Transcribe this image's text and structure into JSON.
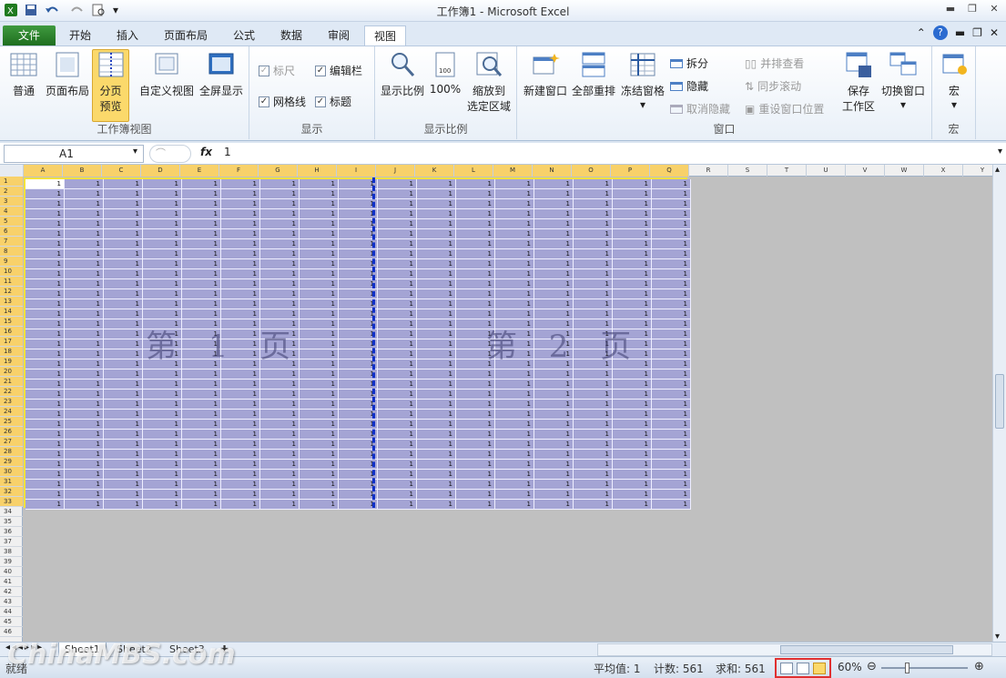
{
  "window": {
    "title": "工作簿1 - Microsoft Excel"
  },
  "tabs": [
    "文件",
    "开始",
    "插入",
    "页面布局",
    "公式",
    "数据",
    "审阅",
    "视图"
  ],
  "ribbon": {
    "workbook_views": {
      "label": "工作簿视图",
      "normal": "普通",
      "page_layout": "页面布局",
      "page_break_1": "分页",
      "page_break_2": "预览",
      "custom": "自定义视图",
      "full": "全屏显示"
    },
    "show": {
      "label": "显示",
      "ruler": "标尺",
      "formula_bar": "编辑栏",
      "gridlines": "网格线",
      "headings": "标题"
    },
    "zoom": {
      "label": "显示比例",
      "zoom": "显示比例",
      "hundred": "100%",
      "sel1": "缩放到",
      "sel2": "选定区域"
    },
    "window": {
      "label": "窗口",
      "new": "新建窗口",
      "arrange": "全部重排",
      "freeze": "冻结窗格",
      "split": "拆分",
      "hide": "隐藏",
      "unhide": "取消隐藏",
      "side": "并排查看",
      "sync": "同步滚动",
      "reset": "重设窗口位置",
      "save1": "保存",
      "save2": "工作区",
      "switch": "切换窗口"
    },
    "macro": {
      "label": "宏",
      "macro": "宏"
    }
  },
  "formula_bar": {
    "name_box": "A1",
    "fx": "fx",
    "value": "1"
  },
  "grid": {
    "columns": [
      "A",
      "B",
      "C",
      "D",
      "E",
      "F",
      "G",
      "H",
      "I",
      "J",
      "K",
      "L",
      "M",
      "N",
      "O",
      "P",
      "Q",
      "R",
      "S",
      "T",
      "U",
      "V",
      "W",
      "X",
      "Y"
    ],
    "selected_columns": 17,
    "rows": 46,
    "selected_rows": 33,
    "cell_value": "1",
    "page1": "第 1 页",
    "page2": "第 2 页"
  },
  "sheets": [
    "Sheet1",
    "Sheet2",
    "Sheet3"
  ],
  "status": {
    "average": "平均值: 1",
    "count": "计数: 561",
    "sum": "求和: 561",
    "zoom": "60%",
    "ready": "就绪"
  },
  "watermark": "ChinaMBS.com",
  "colors": {
    "selection": "#a4a4d4",
    "page_border": "#f3e23b",
    "page_break": "#1030c8",
    "file_tab": "#2a7f2a"
  }
}
